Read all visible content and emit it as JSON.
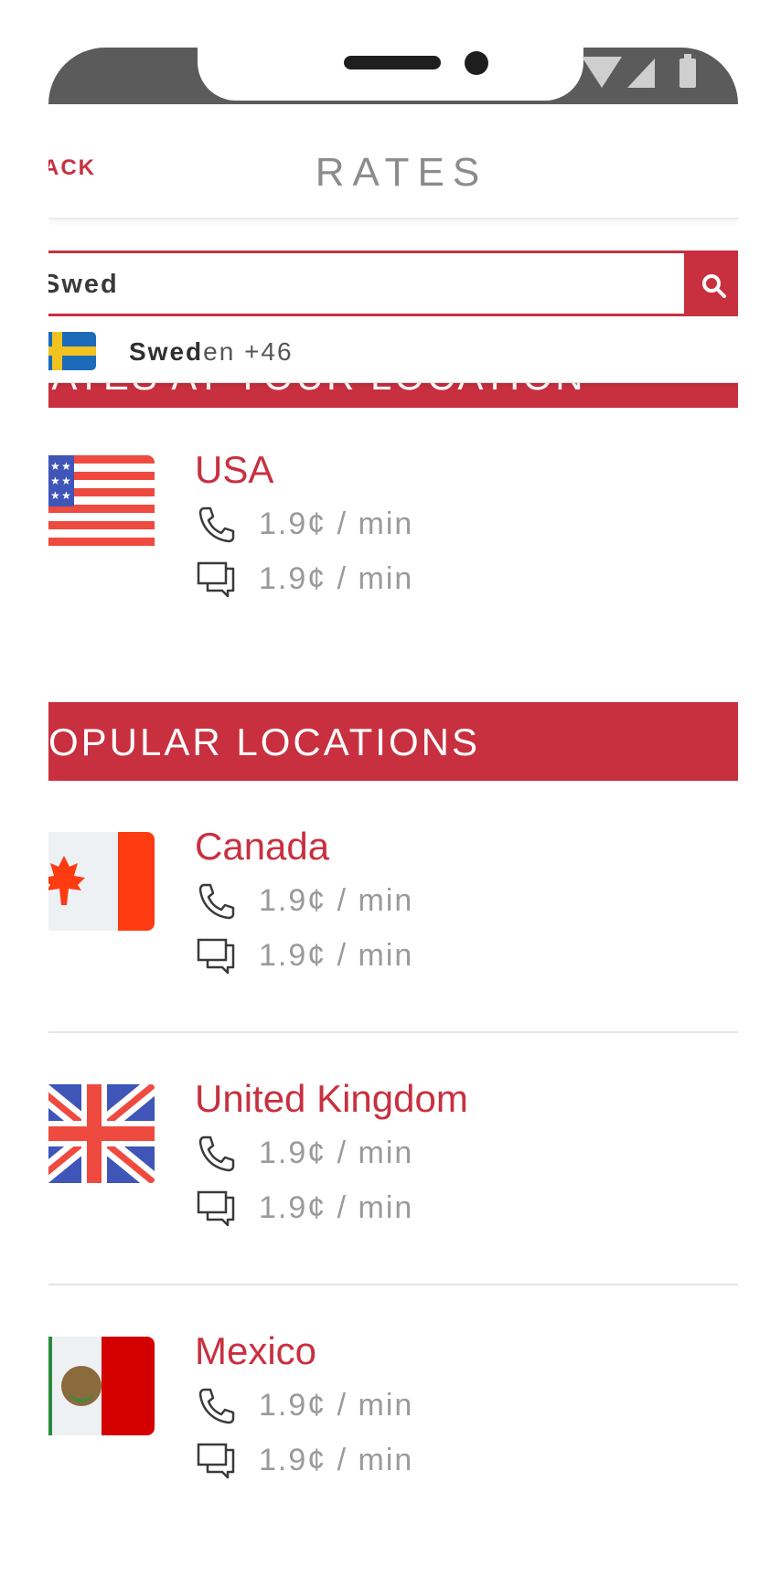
{
  "header": {
    "back_label": "ACK",
    "title": "RATES"
  },
  "search": {
    "value": "Swed"
  },
  "suggestion": {
    "match": "Swed",
    "rest": "en +46"
  },
  "sections": {
    "your_location": "RATES AT YOUR LOCATION",
    "popular": "OPULAR LOCATIONS"
  },
  "locations": [
    {
      "name": "USA",
      "call_rate": "1.9¢ / min",
      "sms_rate": "1.9¢ / min",
      "flag": "usa-flag"
    },
    {
      "name": "Canada",
      "call_rate": "1.9¢ / min",
      "sms_rate": "1.9¢ / min",
      "flag": "canada-flag"
    },
    {
      "name": "United Kingdom",
      "call_rate": "1.9¢ / min",
      "sms_rate": "1.9¢ / min",
      "flag": "uk-flag"
    },
    {
      "name": "Mexico",
      "call_rate": "1.9¢ / min",
      "sms_rate": "1.9¢ / min",
      "flag": "mexico-flag"
    }
  ],
  "icons": {
    "call": "phone-icon",
    "sms": "chat-icon",
    "search": "search-icon"
  },
  "colors": {
    "accent": "#c8303f",
    "muted_text": "#9a9a9a",
    "title_text": "#8c8c8c"
  }
}
